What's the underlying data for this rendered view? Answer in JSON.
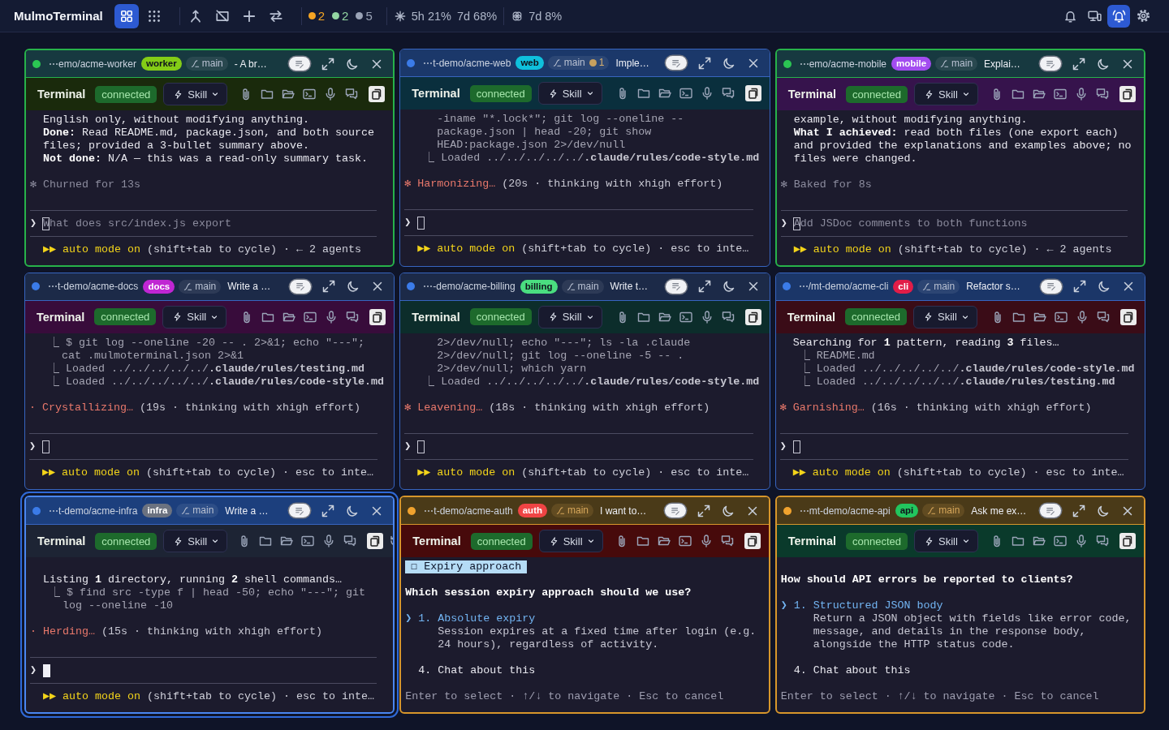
{
  "topbar": {
    "title": "MulmoTerminal",
    "layouts": [
      {
        "kind": "tiles",
        "selected": true
      },
      {
        "kind": "dense",
        "selected": false
      }
    ],
    "counts": [
      {
        "color": "#f5a524",
        "count": "2"
      },
      {
        "color": "#93d6a2",
        "count": "2"
      },
      {
        "color": "#9aa3b6",
        "count": "5"
      }
    ],
    "usage": [
      {
        "kind": "asterisk",
        "readings": [
          "5h 21%",
          "7d 68%"
        ]
      },
      {
        "kind": "knot",
        "readings": [
          "7d 8%"
        ]
      }
    ],
    "actions": [
      {
        "kind": "bell",
        "selected": false
      },
      {
        "kind": "devices",
        "selected": false
      },
      {
        "kind": "alert",
        "selected": true
      },
      {
        "kind": "settings",
        "selected": false
      }
    ]
  },
  "panels": [
    {
      "path": "⋯emo/acme-worker",
      "kind": "done",
      "focused": false,
      "tag": {
        "label": "worker",
        "color": "#84cc16"
      },
      "branch": {
        "name": "main"
      },
      "title": "- A br…",
      "header": {
        "color": "#173940"
      },
      "toolbar": {
        "label": "Terminal",
        "connection": "connected",
        "skill": "Skill",
        "color": "#1a2a0c"
      },
      "lines": [
        {
          "kind": "text",
          "text": "English only, without modifying anything."
        },
        {
          "kind": "text",
          "text": "**Done:** Read README.md, package.json, and both source"
        },
        {
          "kind": "text",
          "text": "files; provided a 3-bullet summary above."
        },
        {
          "kind": "text",
          "text": "**Not done:** N/A — this was a read-only summary task."
        },
        {
          "kind": "blank"
        },
        {
          "kind": "summary",
          "text": "✻ Churned for 13s"
        },
        {
          "kind": "blank"
        }
      ],
      "prompt": {
        "symbol": "❯",
        "placeholder": "What does src/index.js export"
      },
      "footer": {
        "mode": "▶▶ auto mode on",
        "hint": "(shift+tab to cycle) · ← 2 agents"
      }
    },
    {
      "path": "⋯t-demo/acme-web",
      "kind": "running",
      "focused": false,
      "tag": {
        "label": "web",
        "color": "#0fc0dc"
      },
      "branch": {
        "name": "main",
        "changes": "1"
      },
      "title": "Imple…",
      "header": {
        "color": "#1b386a"
      },
      "toolbar": {
        "label": "Terminal",
        "connection": "connected",
        "skill": "Skill",
        "color": "#0a2f3d"
      },
      "lines": [
        {
          "kind": "cmd",
          "text": "-iname \"*.lock*\"; git log --oneline --"
        },
        {
          "kind": "cmd",
          "text": "package.json | head -20; git show"
        },
        {
          "kind": "cmd",
          "text": "HEAD:package.json 2>/dev/null"
        },
        {
          "kind": "tree",
          "text": "⎿ Loaded ../../../../../**.claude/rules/code-style.md**"
        },
        {
          "kind": "blank"
        },
        {
          "kind": "spinner",
          "verb": "✻ Harmonizing…",
          "detail": "(20s · thinking with xhigh effort)"
        },
        {
          "kind": "blank"
        }
      ],
      "prompt": {
        "symbol": "❯"
      },
      "footer": {
        "mode": "▶▶ auto mode on",
        "hint": "(shift+tab to cycle) · esc to inte…"
      }
    },
    {
      "path": "⋯emo/acme-mobile",
      "kind": "done",
      "focused": false,
      "tag": {
        "label": "mobile",
        "color": "#a34cf0"
      },
      "branch": {
        "name": "main"
      },
      "title": "Explai…",
      "header": {
        "color": "#173940"
      },
      "toolbar": {
        "label": "Terminal",
        "connection": "connected",
        "skill": "Skill",
        "color": "#36134c"
      },
      "lines": [
        {
          "kind": "text",
          "text": "example, without modifying anything."
        },
        {
          "kind": "text",
          "text": "**What I achieved:** read both files (one export each)"
        },
        {
          "kind": "text",
          "text": "and provided the explanations and examples above; no"
        },
        {
          "kind": "text",
          "text": "files were changed."
        },
        {
          "kind": "blank"
        },
        {
          "kind": "summary",
          "text": "✻ Baked for 8s"
        },
        {
          "kind": "blank"
        }
      ],
      "prompt": {
        "symbol": "❯",
        "placeholder": "Add JSDoc comments to both functions"
      },
      "footer": {
        "mode": "▶▶ auto mode on",
        "hint": "(shift+tab to cycle) · ← 2 agents"
      }
    },
    {
      "path": "⋯t-demo/acme-docs",
      "kind": "running",
      "focused": false,
      "tag": {
        "label": "docs",
        "color": "#c026d3"
      },
      "branch": {
        "name": "main"
      },
      "title": "Write a …",
      "header": {
        "color": "#1c2a48"
      },
      "toolbar": {
        "label": "Terminal",
        "connection": "connected",
        "skill": "Skill",
        "color": "#380c3b"
      },
      "lines": [
        {
          "kind": "tree",
          "text": "⎿ $ git log --oneline -20 -- . 2>&1; echo \"---\";"
        },
        {
          "kind": "cmd",
          "text": "cat .mulmoterminal.json 2>&1"
        },
        {
          "kind": "tree",
          "text": "⎿ Loaded ../../../../../**.claude/rules/testing.md**"
        },
        {
          "kind": "tree",
          "text": "⎿ Loaded ../../../../../**.claude/rules/code-style.md**"
        },
        {
          "kind": "blank"
        },
        {
          "kind": "spinner",
          "verb": "· Crystallizing…",
          "detail": "(19s · thinking with xhigh effort)"
        },
        {
          "kind": "blank"
        }
      ],
      "prompt": {
        "symbol": "❯"
      },
      "footer": {
        "mode": "▶▶ auto mode on",
        "hint": "(shift+tab to cycle) · esc to inte…"
      }
    },
    {
      "path": "⋯-demo/acme-billing",
      "kind": "running",
      "focused": false,
      "tag": {
        "label": "billing",
        "color": "#4ade80"
      },
      "branch": {
        "name": "main"
      },
      "title": "Write t…",
      "header": {
        "color": "#1c2a48"
      },
      "toolbar": {
        "label": "Terminal",
        "connection": "connected",
        "skill": "Skill",
        "color": "#0c2d2b"
      },
      "lines": [
        {
          "kind": "cmd",
          "text": "2>/dev/null; echo \"---\"; ls -la .claude"
        },
        {
          "kind": "cmd",
          "text": "2>/dev/null; git log --oneline -5 -- ."
        },
        {
          "kind": "cmd",
          "text": "2>/dev/null; which yarn"
        },
        {
          "kind": "tree",
          "text": "⎿ Loaded ../../../../../**.claude/rules/code-style.md**"
        },
        {
          "kind": "blank"
        },
        {
          "kind": "spinner",
          "verb": "✻ Leavening…",
          "detail": "(18s · thinking with xhigh effort)"
        },
        {
          "kind": "blank"
        }
      ],
      "prompt": {
        "symbol": "❯"
      },
      "footer": {
        "mode": "▶▶ auto mode on",
        "hint": "(shift+tab to cycle) · esc to inte…"
      }
    },
    {
      "path": "⋯/mt-demo/acme-cli",
      "kind": "running",
      "focused": false,
      "tag": {
        "label": "cli",
        "color": "#e11d48"
      },
      "branch": {
        "name": "main"
      },
      "title": "Refactor s…",
      "header": {
        "color": "#1b3668"
      },
      "toolbar": {
        "label": "Terminal",
        "connection": "connected",
        "skill": "Skill",
        "color": "#3a0c17"
      },
      "lines": [
        {
          "kind": "text",
          "text": "Searching for **1** pattern, reading **3** files…"
        },
        {
          "kind": "tree",
          "text": "⎿ README.md"
        },
        {
          "kind": "tree",
          "text": "⎿ Loaded ../../../../../**.claude/rules/code-style.md**"
        },
        {
          "kind": "tree",
          "text": "⎿ Loaded ../../../../../**.claude/rules/testing.md**"
        },
        {
          "kind": "blank"
        },
        {
          "kind": "spinner",
          "verb": "✻ Garnishing…",
          "detail": "(16s · thinking with xhigh effort)"
        },
        {
          "kind": "blank"
        }
      ],
      "prompt": {
        "symbol": "❯"
      },
      "footer": {
        "mode": "▶▶ auto mode on",
        "hint": "(shift+tab to cycle) · esc to inte…"
      }
    },
    {
      "path": "⋯t-demo/acme-infra",
      "kind": "running",
      "focused": true,
      "tag": {
        "label": "infra",
        "color": "#6b7280"
      },
      "branch": {
        "name": "main"
      },
      "title": "Write a …",
      "header": {
        "color": "#1c3f7d"
      },
      "toolbar": {
        "label": "Terminal",
        "connection": "connected",
        "skill": "Skill",
        "color": "#1d2434",
        "overflow": true
      },
      "lines": [
        {
          "kind": "blank"
        },
        {
          "kind": "text",
          "text": "Listing **1** directory, running **2** shell commands…"
        },
        {
          "kind": "tree",
          "text": "⎿ $ find src -type f | head -50; echo \"---\"; git"
        },
        {
          "kind": "cmd",
          "text": "log --oneline -10"
        },
        {
          "kind": "blank"
        },
        {
          "kind": "spinner",
          "verb": "· Herding…",
          "detail": "(15s · thinking with xhigh effort)"
        },
        {
          "kind": "blank"
        }
      ],
      "prompt": {
        "symbol": "❯"
      },
      "footer": {
        "mode": "▶▶ auto mode on",
        "hint": "(shift+tab to cycle) · esc to inte…"
      }
    },
    {
      "path": "⋯t-demo/acme-auth",
      "kind": "waiting",
      "focused": false,
      "tag": {
        "label": "auth",
        "color": "#ef4444"
      },
      "branch": {
        "name": "main"
      },
      "title": "I want to…",
      "header": {
        "color": "#4a3a18"
      },
      "toolbar": {
        "label": "Terminal",
        "connection": "connected",
        "skill": "Skill",
        "color": "#470a0b"
      },
      "lines": [
        {
          "kind": "chip",
          "text": "☐ Expiry approach"
        },
        {
          "kind": "blank"
        },
        {
          "kind": "question",
          "text": "Which session expiry approach should we use?"
        },
        {
          "kind": "blank"
        },
        {
          "kind": "option",
          "pointer": "❯",
          "label": "1. Absolute expiry",
          "selected": true
        },
        {
          "kind": "desc",
          "text": "Session expires at a fixed time after login (e.g."
        },
        {
          "kind": "desc",
          "text": "24 hours), regardless of activity."
        },
        {
          "kind": "blank"
        },
        {
          "kind": "option",
          "label": "4. Chat about this",
          "selected": false
        },
        {
          "kind": "blank"
        },
        {
          "kind": "hint",
          "text": "Enter to select · ↑/↓ to navigate · Esc to cancel"
        }
      ]
    },
    {
      "path": "⋯mt-demo/acme-api",
      "kind": "waiting",
      "focused": false,
      "tag": {
        "label": "api",
        "color": "#22c55e"
      },
      "branch": {
        "name": "main"
      },
      "title": "Ask me ex…",
      "header": {
        "color": "#4a3a18"
      },
      "toolbar": {
        "label": "Terminal",
        "connection": "connected",
        "skill": "Skill",
        "color": "#0a3a2b"
      },
      "lines": [
        {
          "kind": "blank"
        },
        {
          "kind": "question",
          "text": "How should API errors be reported to clients?"
        },
        {
          "kind": "blank"
        },
        {
          "kind": "option",
          "pointer": "❯",
          "label": "1. Structured JSON body",
          "selected": true
        },
        {
          "kind": "desc",
          "text": "Return a JSON object with fields like error code,"
        },
        {
          "kind": "desc",
          "text": "message, and details in the response body,"
        },
        {
          "kind": "desc",
          "text": "alongside the HTTP status code."
        },
        {
          "kind": "blank"
        },
        {
          "kind": "option",
          "label": "4. Chat about this",
          "selected": false
        },
        {
          "kind": "blank"
        },
        {
          "kind": "hint",
          "text": "Enter to select · ↑/↓ to navigate · Esc to cancel"
        }
      ]
    }
  ]
}
